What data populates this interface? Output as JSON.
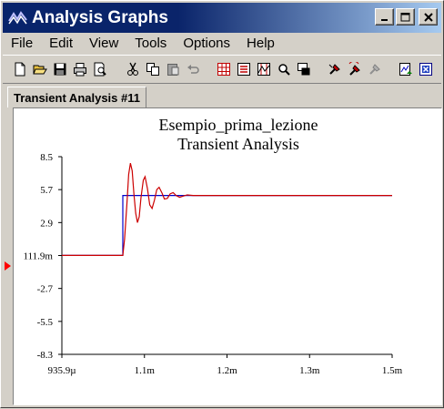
{
  "window": {
    "title": "Analysis Graphs",
    "icon": "analysis-app-icon",
    "controls": [
      "minimize",
      "maximize",
      "close"
    ]
  },
  "menu": [
    "File",
    "Edit",
    "View",
    "Tools",
    "Options",
    "Help"
  ],
  "toolbar": {
    "buttons": [
      "new-icon",
      "open-icon",
      "save-icon",
      "print-icon",
      "print-preview-icon",
      "cut-icon",
      "copy-icon",
      "paste-icon",
      "undo-icon",
      "grid-icon",
      "legend-icon",
      "cursors-icon",
      "zoom-icon",
      "overview-icon",
      "probe-icon",
      "probe-arrow-icon",
      "probe-disabled-icon",
      "export-icon",
      "excel-export-icon"
    ]
  },
  "tabs": [
    {
      "label": "Transient Analysis #11",
      "active": true
    }
  ],
  "chart_data": {
    "type": "line",
    "title": "Esempio_prima_lezione",
    "subtitle": "Transient Analysis",
    "xlabel": "",
    "ylabel": "",
    "x_tick_labels": [
      "935.9µ",
      "1.1m",
      "1.2m",
      "1.3m",
      "1.5m"
    ],
    "y_tick_labels": [
      "8.5",
      "5.7",
      "2.9",
      "111.9m",
      "-2.7",
      "-5.5",
      "-8.3"
    ],
    "xlim": [
      0.0009359,
      0.0015
    ],
    "ylim": [
      -8.3,
      8.5
    ],
    "series": [
      {
        "color": "#0000cc",
        "description": "step input",
        "points": [
          [
            0.0009359,
            0.1119
          ],
          [
            0.00104,
            0.1119
          ],
          [
            0.00104,
            5.2
          ],
          [
            0.0015,
            5.2
          ]
        ]
      },
      {
        "color": "#cc0000",
        "description": "damped oscillating response",
        "points": [
          [
            0.0009359,
            0.1119
          ],
          [
            0.00104,
            0.1119
          ],
          [
            0.001043,
            1.5
          ],
          [
            0.001047,
            4.5
          ],
          [
            0.00105,
            7.0
          ],
          [
            0.001053,
            7.95
          ],
          [
            0.001056,
            7.3
          ],
          [
            0.001059,
            5.3
          ],
          [
            0.001062,
            3.7
          ],
          [
            0.001065,
            2.9
          ],
          [
            0.001068,
            3.4
          ],
          [
            0.001071,
            5.0
          ],
          [
            0.001075,
            6.5
          ],
          [
            0.001078,
            6.8
          ],
          [
            0.001082,
            5.8
          ],
          [
            0.001086,
            4.4
          ],
          [
            0.00109,
            4.1
          ],
          [
            0.001094,
            4.8
          ],
          [
            0.001098,
            5.7
          ],
          [
            0.001102,
            5.9
          ],
          [
            0.001107,
            5.4
          ],
          [
            0.001111,
            4.9
          ],
          [
            0.001116,
            4.95
          ],
          [
            0.001121,
            5.35
          ],
          [
            0.001126,
            5.45
          ],
          [
            0.001131,
            5.2
          ],
          [
            0.001137,
            5.05
          ],
          [
            0.001143,
            5.15
          ],
          [
            0.00115,
            5.25
          ],
          [
            0.00116,
            5.2
          ],
          [
            0.0015,
            5.2
          ]
        ]
      }
    ],
    "grid": false,
    "legend": "none",
    "cursor_marker_value": "111.9m"
  }
}
